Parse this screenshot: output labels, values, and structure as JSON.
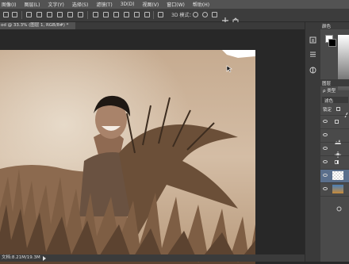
{
  "menu": [
    "图像(I)",
    "图层(L)",
    "文字(Y)",
    "选择(S)",
    "滤镜(T)",
    "3D(D)",
    "视图(V)",
    "窗口(W)",
    "帮助(H)"
  ],
  "options": {
    "mode": "3D 模式："
  },
  "document": {
    "tab": "od @ 33.3% (图层 1, RGB/8#) *"
  },
  "status": {
    "doc_size": "文档:8.21M/19.3M"
  },
  "panels": {
    "color_tab": "颜色",
    "layers_tab": "图层",
    "kind_label": "ρ 类型",
    "blend_mode": "滤色",
    "lock_label": "锁定"
  },
  "colors": {
    "accent": "#4a8cd6",
    "menubar": "#535353",
    "panel": "#4a4a4a"
  }
}
